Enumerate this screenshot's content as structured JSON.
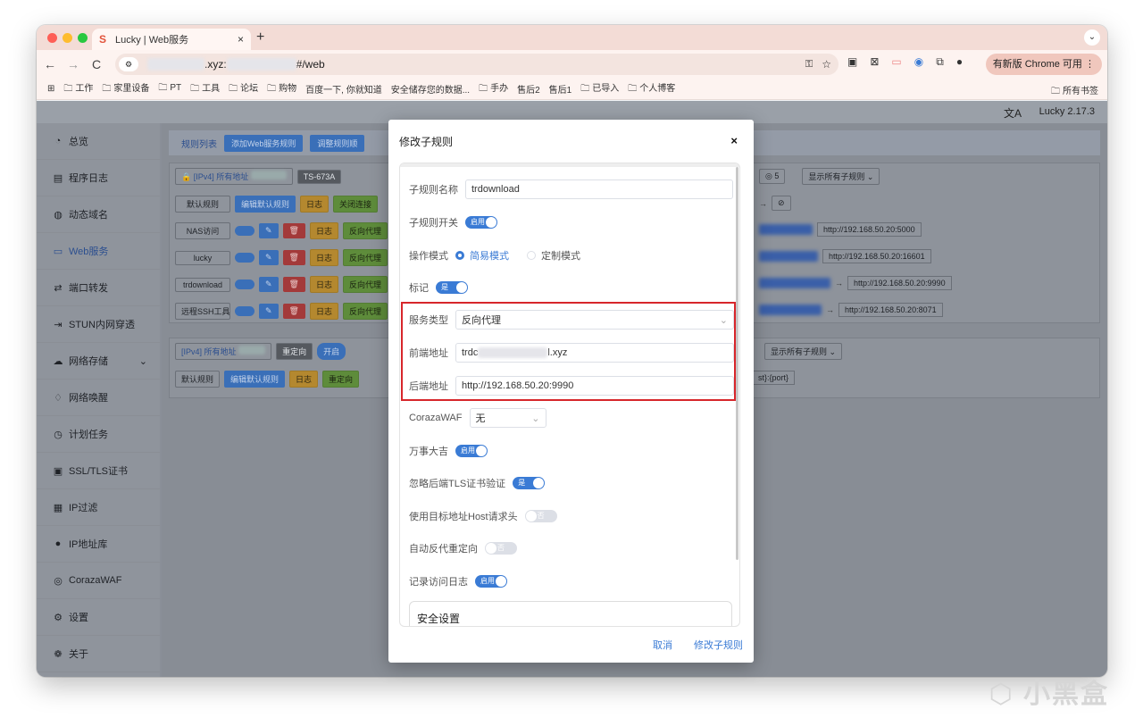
{
  "browser": {
    "tab_title": "Lucky | Web服务",
    "tab_close": "×",
    "new_tab": "+",
    "url_suffix": ".xyz:",
    "url_path": "#/web",
    "update_label": "有新版 Chrome 可用",
    "bookmarks": [
      "工作",
      "家里设备",
      "PT",
      "工具",
      "论坛",
      "购物",
      "百度一下, 你就知道",
      "安全储存您的数据...",
      "手办",
      "售后2",
      "售后1",
      "已导入",
      "个人博客"
    ],
    "bookmarks_all": "所有书签"
  },
  "app": {
    "version": "Lucky 2.17.3",
    "sidebar": [
      {
        "icon": "dashboard-icon",
        "label": "总览"
      },
      {
        "icon": "log-icon",
        "label": "程序日志"
      },
      {
        "icon": "ddns-icon",
        "label": "动态域名"
      },
      {
        "icon": "web-icon",
        "label": "Web服务"
      },
      {
        "icon": "port-forward-icon",
        "label": "端口转发"
      },
      {
        "icon": "stun-icon",
        "label": "STUN内网穿透"
      },
      {
        "icon": "storage-icon",
        "label": "网络存储"
      },
      {
        "icon": "wol-icon",
        "label": "网络唤醒"
      },
      {
        "icon": "schedule-icon",
        "label": "计划任务"
      },
      {
        "icon": "ssl-icon",
        "label": "SSL/TLS证书"
      },
      {
        "icon": "ip-filter-icon",
        "label": "IP过滤"
      },
      {
        "icon": "ip-db-icon",
        "label": "IP地址库"
      },
      {
        "icon": "waf-icon",
        "label": "CorazaWAF"
      },
      {
        "icon": "settings-icon",
        "label": "设置"
      },
      {
        "icon": "about-icon",
        "label": "关于"
      }
    ],
    "tabs": {
      "rule_list": "规则列表",
      "add_rule": "添加Web服务规则",
      "adjust": "调整规则顺"
    },
    "card1": {
      "title": "[IPv4]",
      "subtitle": "所有地址",
      "device": "TS-673A",
      "count": "5",
      "show_all": "显示所有子规则",
      "rows": [
        {
          "name": "默认规则",
          "edit": "编辑默认规则",
          "log": "日志",
          "action": "关闭连接"
        },
        {
          "name": "NAS访问",
          "log": "日志",
          "action": "反向代理",
          "target": "http://192.168.50.20:5000"
        },
        {
          "name": "lucky",
          "log": "日志",
          "action": "反向代理",
          "target": "http://192.168.50.20:16601"
        },
        {
          "name": "trdownload",
          "log": "日志",
          "action": "反向代理",
          "target": "http://192.168.50.20:9990"
        },
        {
          "name": "远程SSH工具",
          "log": "日志",
          "action": "反向代理",
          "target": "http://192.168.50.20:8071"
        }
      ]
    },
    "card2": {
      "title": "[IPv4]",
      "subtitle": "所有地址",
      "redirect": "重定向",
      "toggle": "开启",
      "show_all": "显示所有子规则",
      "default": "默认规则",
      "edit": "编辑默认规则",
      "log": "日志",
      "action": "重定向",
      "target": "st}:{port}"
    }
  },
  "modal": {
    "title": "修改子规则",
    "close": "×",
    "name_label": "子规则名称",
    "name_value": "trdownload",
    "switch_label": "子规则开关",
    "switch_value": "启用",
    "mode_label": "操作模式",
    "mode_simple": "简易模式",
    "mode_custom": "定制模式",
    "mark_label": "标记",
    "mark_value": "是",
    "service_label": "服务类型",
    "service_value": "反向代理",
    "front_label": "前端地址",
    "front_prefix": "trdc",
    "front_suffix": "l.xyz",
    "back_label": "后端地址",
    "back_value": "http://192.168.50.20:9990",
    "waf_label": "CorazaWAF",
    "waf_value": "无",
    "wanshi_label": "万事大吉",
    "wanshi_value": "启用",
    "ignore_tls_label": "忽略后端TLS证书验证",
    "ignore_tls_value": "是",
    "use_host_label": "使用目标地址Host请求头",
    "use_host_value": "否",
    "auto_redirect_label": "自动反代重定向",
    "auto_redirect_value": "否",
    "access_log_label": "记录访问日志",
    "access_log_value": "启用",
    "security_title": "安全设置",
    "cancel": "取消",
    "submit": "修改子规则"
  },
  "watermark": "小黑盒"
}
